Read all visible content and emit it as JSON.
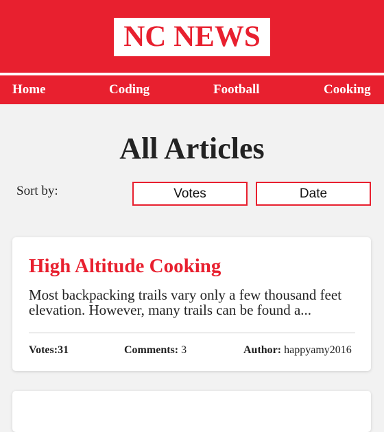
{
  "header": {
    "logo": "NC NEWS",
    "brand_color": "#e8202f"
  },
  "nav": {
    "items": [
      {
        "label": "Home"
      },
      {
        "label": "Coding"
      },
      {
        "label": "Football"
      },
      {
        "label": "Cooking"
      }
    ]
  },
  "main": {
    "title": "All Articles",
    "sort": {
      "label": "Sort by:",
      "options": [
        "Votes",
        "Date"
      ]
    },
    "articles": [
      {
        "title": "High Altitude Cooking",
        "excerpt": "Most backpacking trails vary only a few thousand feet elevation. However, many trails can be found a...",
        "votes_label": "Votes:",
        "votes": "31",
        "comments_label": "Comments:",
        "comments": "3",
        "author_label": "Author:",
        "author": "happyamy2016"
      }
    ]
  }
}
